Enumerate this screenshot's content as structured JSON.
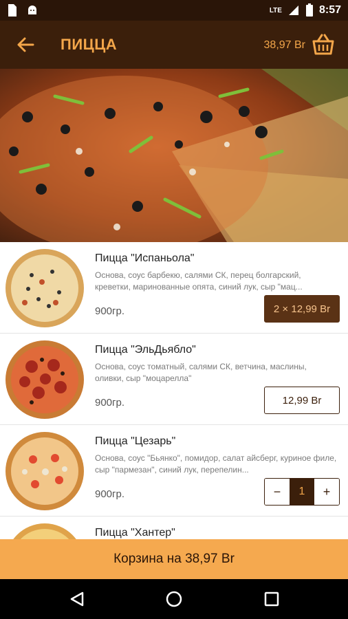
{
  "status_bar": {
    "network": "LTE",
    "time": "8:57"
  },
  "app_bar": {
    "title": "ПИЦЦА",
    "cart_total": "38,97 Br"
  },
  "items": [
    {
      "name": "Пицца \"Испаньола\"",
      "description": "Основа, соус барбекю, салями СК, перец болгарский, креветки, маринованные опята, синий лук, сыр \"мац...",
      "weight": "900гр.",
      "price_label": "2 × 12,99 Br"
    },
    {
      "name": "Пицца \"ЭльДьябло\"",
      "description": "Основа, соус томатный, салями СК, ветчина, маслины, оливки, сыр \"моцарелла\"",
      "weight": "900гр.",
      "price_label": "12,99 Br"
    },
    {
      "name": "Пицца \"Цезарь\"",
      "description": "Основа, соус \"Бьянко\", помидор, салат айсберг, куриное филе, сыр \"пармезан\", синий лук, перепелин...",
      "weight": "900гр.",
      "quantity": "1",
      "minus": "−",
      "plus": "+"
    },
    {
      "name": "Пицца \"Хантер\""
    }
  ],
  "cart_bar": {
    "label": "Корзина на 38,97 Br"
  },
  "colors": {
    "appbar": "#3b1f0b",
    "accent": "#f3a64a",
    "cartbar": "#f5a94f",
    "active_price": "#5a3215"
  }
}
